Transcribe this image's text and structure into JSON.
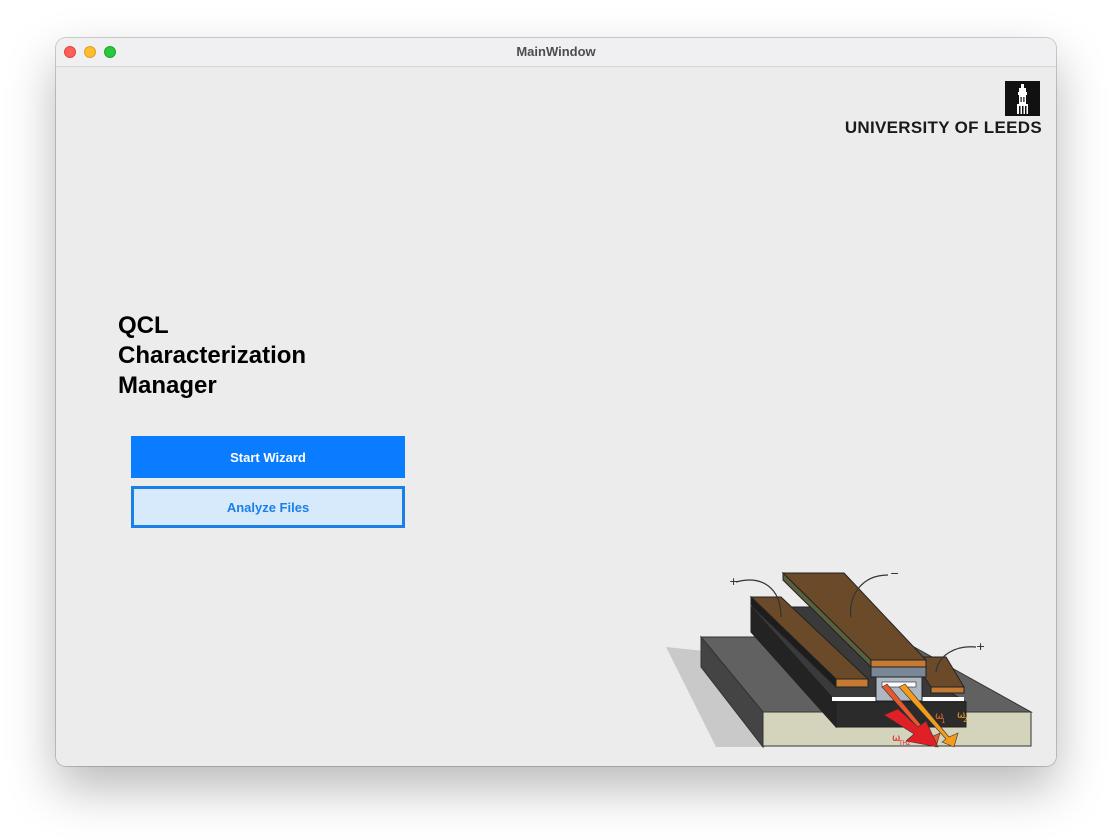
{
  "window": {
    "title": "MainWindow"
  },
  "logo": {
    "text": "UNIVERSITY OF LEEDS",
    "icon": "tower-icon"
  },
  "main": {
    "title": "QCL\nCharacterization\nManager",
    "start_wizard_label": "Start Wizard",
    "analyze_files_label": "Analyze Files"
  },
  "illustration": {
    "label_plus_left": "+",
    "label_minus": "−",
    "label_plus_right": "+",
    "omega1_label": "ω",
    "omega1_sub": "1",
    "omega2_label": "ω",
    "omega2_sub": "2",
    "omega_thz_label": "ω",
    "omega_thz_sub": "THz"
  },
  "colors": {
    "primary": "#0a7cff",
    "secondary_bg": "#d6eafc",
    "secondary_text": "#1a80e8",
    "window_bg": "#ececec"
  }
}
